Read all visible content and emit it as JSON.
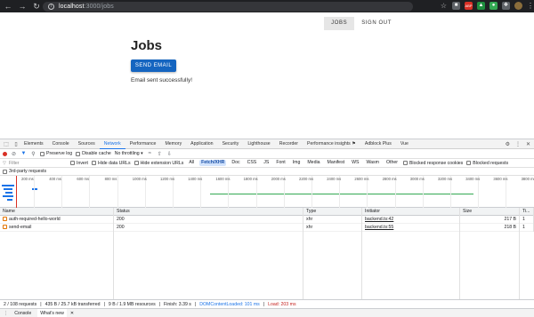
{
  "browser": {
    "url_host": "localhost",
    "url_path": ":3000/jobs",
    "ext_badge": "ABP"
  },
  "page": {
    "nav": [
      "JOBS",
      "SIGN OUT"
    ],
    "title": "Jobs",
    "send_button": "SEND EMAIL",
    "status_message": "Email sent successfully!"
  },
  "devtools": {
    "tabs": [
      "Elements",
      "Console",
      "Sources",
      "Network",
      "Performance",
      "Memory",
      "Application",
      "Security",
      "Lighthouse",
      "Recorder",
      "Performance insights ⚑",
      "Adblock Plus",
      "Vue"
    ],
    "active_tab": "Network",
    "toolbar": {
      "preserve_log": "Preserve log",
      "disable_cache": "Disable cache",
      "throttling": "No throttling"
    },
    "filter": {
      "placeholder": "Filter",
      "invert": "Invert",
      "hide_data_urls": "Hide data URLs",
      "hide_ext_urls": "Hide extension URLs",
      "types": [
        "All",
        "Fetch/XHR",
        "Doc",
        "CSS",
        "JS",
        "Font",
        "Img",
        "Media",
        "Manifest",
        "WS",
        "Wasm",
        "Other"
      ],
      "active_type": "Fetch/XHR",
      "blocked_cookies": "Blocked response cookies",
      "blocked_requests": "Blocked requests"
    },
    "third_party": "3rd-party requests",
    "timeline_ticks": [
      "200 ms",
      "400 ms",
      "600 ms",
      "800 ms",
      "1000 ms",
      "1200 ms",
      "1400 ms",
      "1600 ms",
      "1800 ms",
      "2000 ms",
      "2200 ms",
      "2400 ms",
      "2600 ms",
      "2800 ms",
      "3000 ms",
      "3200 ms",
      "3400 ms",
      "3600 ms",
      "3800 ms"
    ],
    "columns": [
      "Name",
      "Status",
      "Type",
      "Initiator",
      "Size",
      "Ti..."
    ],
    "rows": [
      {
        "name": "auth-required-hello-world",
        "status": "200",
        "type": "xhr",
        "initiator": "backend.ts:42",
        "size": "217 B",
        "time": "1"
      },
      {
        "name": "send-email",
        "status": "200",
        "type": "xhr",
        "initiator": "backend.ts:55",
        "size": "218 B",
        "time": "1"
      }
    ],
    "statusbar": {
      "requests": "2 / 108 requests",
      "transferred": "435 B / 25.7 kB transferred",
      "resources": "9 B / 1.9 MB resources",
      "finish": "Finish: 3.39 s",
      "dcl": "DOMContentLoaded: 101 ms",
      "load": "Load: 203 ms"
    },
    "drawer": [
      "Console",
      "What's new"
    ]
  }
}
